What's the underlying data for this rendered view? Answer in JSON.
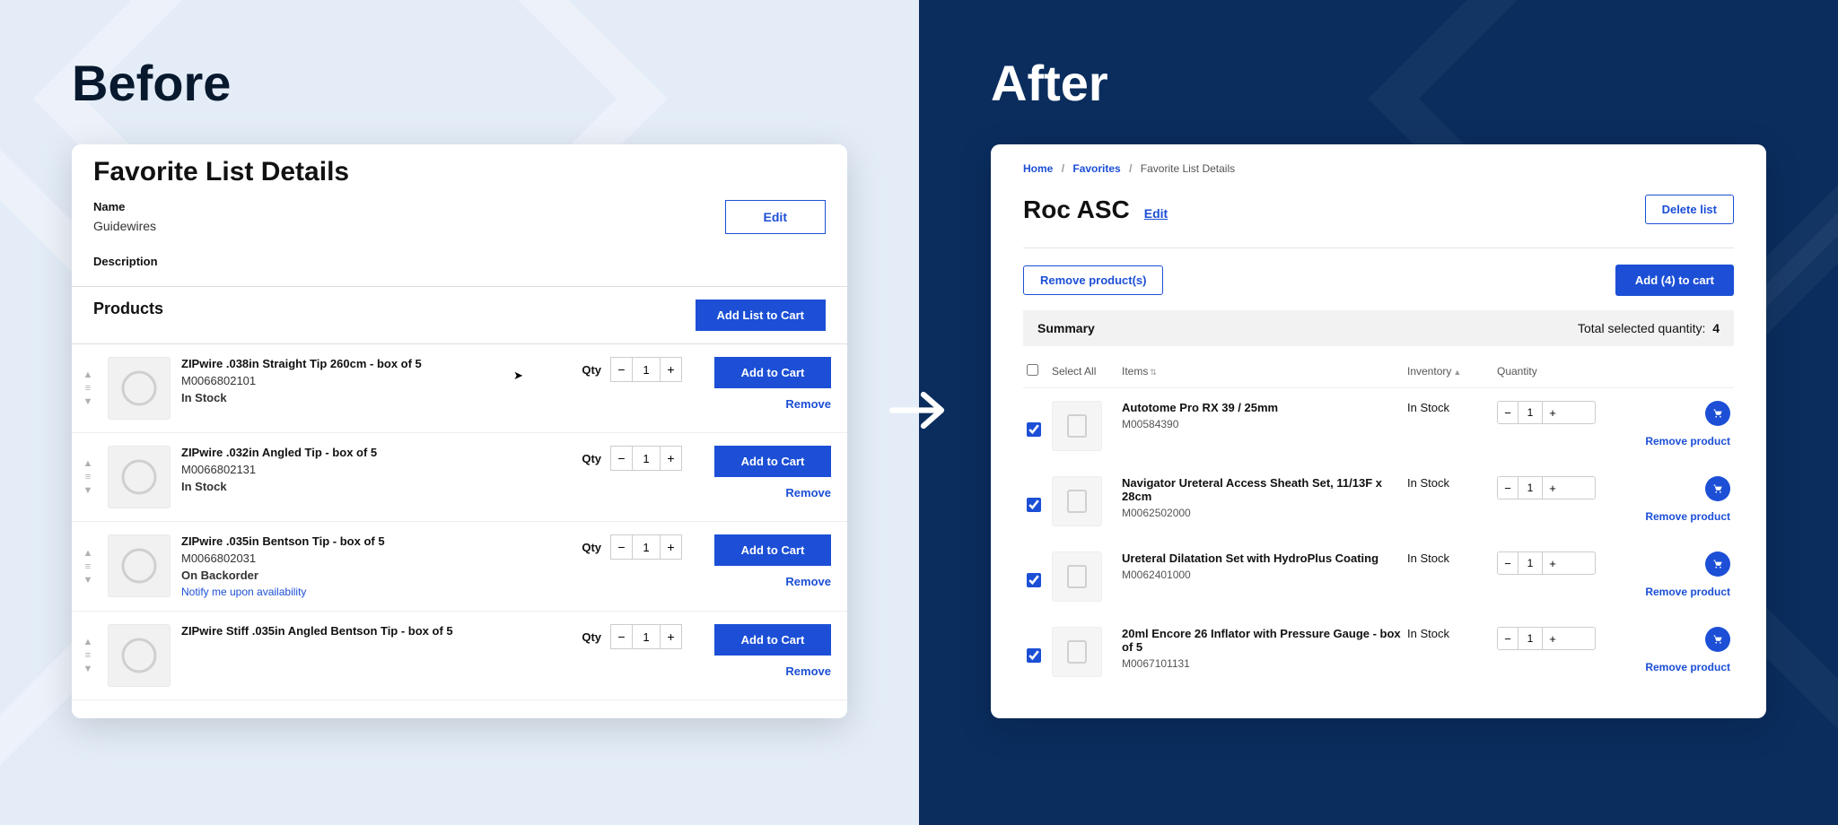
{
  "left": {
    "big_title": "Before",
    "page_title": "Favorite List Details",
    "name_label": "Name",
    "name_value": "Guidewires",
    "desc_label": "Description",
    "edit_button": "Edit",
    "products_heading": "Products",
    "add_list_to_cart": "Add List to Cart",
    "qty_label": "Qty",
    "add_to_cart": "Add to Cart",
    "remove": "Remove",
    "products": [
      {
        "name": "ZIPwire .038in Straight Tip 260cm - box of 5",
        "sku": "M0066802101",
        "stock": "In Stock",
        "qty": "1"
      },
      {
        "name": "ZIPwire .032in Angled Tip - box of 5",
        "sku": "M0066802131",
        "stock": "In Stock",
        "qty": "1"
      },
      {
        "name": "ZIPwire .035in Bentson Tip - box of 5",
        "sku": "M0066802031",
        "stock": "On Backorder",
        "notify": "Notify me upon availability",
        "qty": "1"
      },
      {
        "name": "ZIPwire Stiff .035in Angled Bentson Tip - box of 5",
        "sku": "",
        "stock": "",
        "qty": "1"
      }
    ]
  },
  "right": {
    "big_title": "After",
    "crumbs": {
      "home": "Home",
      "fav": "Favorites",
      "cur": "Favorite List Details"
    },
    "page_title": "Roc ASC",
    "edit": "Edit",
    "delete_list": "Delete list",
    "remove_products": "Remove product(s)",
    "add_to_cart_btn": "Add (4) to cart",
    "summary_label": "Summary",
    "total_qty_label": "Total selected quantity:",
    "total_qty_value": "4",
    "select_all": "Select All",
    "headers": {
      "items": "Items",
      "inventory": "Inventory",
      "quantity": "Quantity"
    },
    "remove_product": "Remove product",
    "items": [
      {
        "name": "Autotome Pro RX 39 / 25mm",
        "sku": "M00584390",
        "stock": "In Stock",
        "qty": "1"
      },
      {
        "name": "Navigator Ureteral Access Sheath Set, 11/13F x 28cm",
        "sku": "M0062502000",
        "stock": "In Stock",
        "qty": "1"
      },
      {
        "name": "Ureteral Dilatation Set with HydroPlus Coating",
        "sku": "M0062401000",
        "stock": "In Stock",
        "qty": "1"
      },
      {
        "name": "20ml Encore 26 Inflator with Pressure Gauge - box of 5",
        "sku": "M0067101131",
        "stock": "In Stock",
        "qty": "1"
      }
    ]
  }
}
